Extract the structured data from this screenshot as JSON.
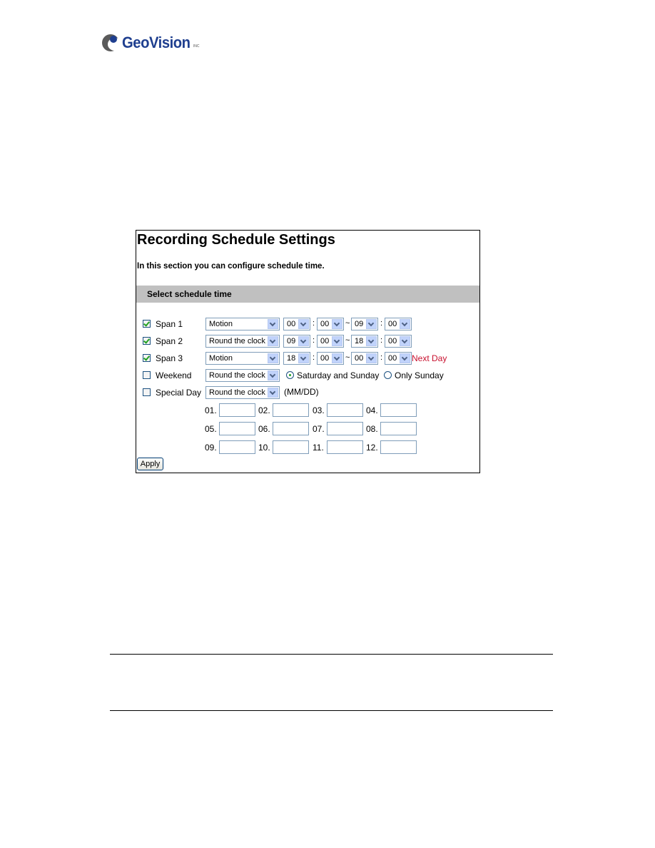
{
  "brand": {
    "name": "GeoVision",
    "tm": "INC"
  },
  "panel": {
    "title": "Recording Schedule Settings",
    "description": "In this section you can configure schedule time.",
    "section_header": "Select schedule time",
    "spans": [
      {
        "label": "Span 1",
        "checked": true,
        "mode": "Motion",
        "start_hour": "00",
        "start_min": "00",
        "end_hour": "09",
        "end_min": "00",
        "note": ""
      },
      {
        "label": "Span 2",
        "checked": true,
        "mode": "Round the clock",
        "start_hour": "09",
        "start_min": "00",
        "end_hour": "18",
        "end_min": "00",
        "note": ""
      },
      {
        "label": "Span 3",
        "checked": true,
        "mode": "Motion",
        "start_hour": "18",
        "start_min": "00",
        "end_hour": "00",
        "end_min": "00",
        "note": "Next Day"
      }
    ],
    "time_separator": ":",
    "range_separator": "~",
    "weekend": {
      "label": "Weekend",
      "checked": false,
      "mode": "Round the clock",
      "options": [
        {
          "label": "Saturday and Sunday",
          "selected": true
        },
        {
          "label": "Only Sunday",
          "selected": false
        }
      ]
    },
    "special_day": {
      "label": "Special Day",
      "checked": false,
      "mode": "Round the clock",
      "format_hint": "(MM/DD)",
      "dates": [
        {
          "label": "01.",
          "value": ""
        },
        {
          "label": "02.",
          "value": ""
        },
        {
          "label": "03.",
          "value": ""
        },
        {
          "label": "04.",
          "value": ""
        },
        {
          "label": "05.",
          "value": ""
        },
        {
          "label": "06.",
          "value": ""
        },
        {
          "label": "07.",
          "value": ""
        },
        {
          "label": "08.",
          "value": ""
        },
        {
          "label": "09.",
          "value": ""
        },
        {
          "label": "10.",
          "value": ""
        },
        {
          "label": "11.",
          "value": ""
        },
        {
          "label": "12.",
          "value": ""
        }
      ]
    },
    "apply_label": "Apply"
  },
  "colors": {
    "brand_blue": "#1f3f8f",
    "next_day_red": "#c8102e",
    "section_gray": "#c0c0c0",
    "check_green": "#21a121"
  }
}
